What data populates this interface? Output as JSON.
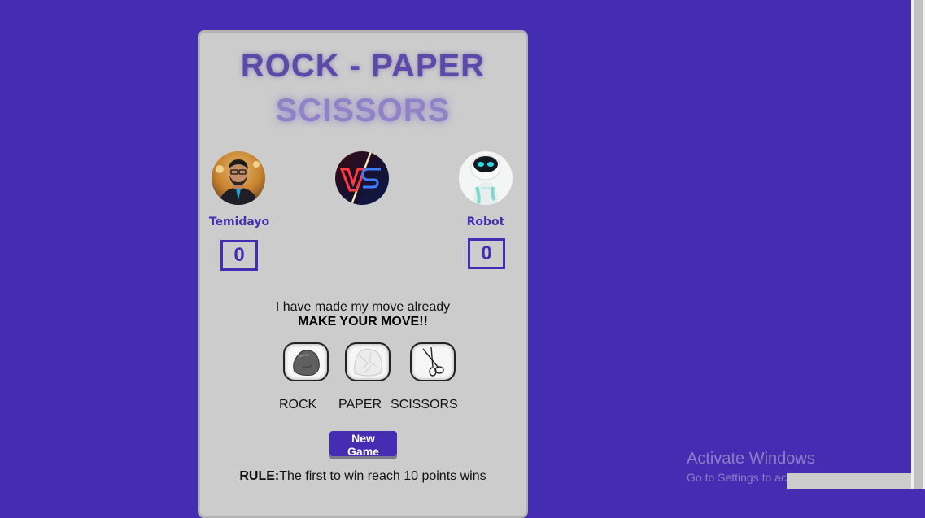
{
  "game": {
    "title_line1": "ROCK - PAPER",
    "title_line2": "SCISSORS",
    "player": {
      "name": "Temidayo",
      "score": "0"
    },
    "opponent": {
      "name": "Robot",
      "score": "0"
    },
    "vs_icon": "vs-badge-icon",
    "status_message": "I have made my move already",
    "prompt": "MAKE YOUR MOVE!!",
    "choices": [
      {
        "label": "ROCK",
        "icon": "rock-icon"
      },
      {
        "label": "PAPER",
        "icon": "paper-icon"
      },
      {
        "label": "SCISSORS",
        "icon": "scissors-icon"
      }
    ],
    "new_game_label": "New Game",
    "rule_prefix": "RULE:",
    "rule_text": "The first to win reach 10 points wins"
  },
  "watermark": {
    "line1": "Activate Windows",
    "line2": "Go to Settings to activate Windows."
  },
  "colors": {
    "background": "#452db3",
    "card": "#cccccc",
    "accent": "#452db3"
  }
}
